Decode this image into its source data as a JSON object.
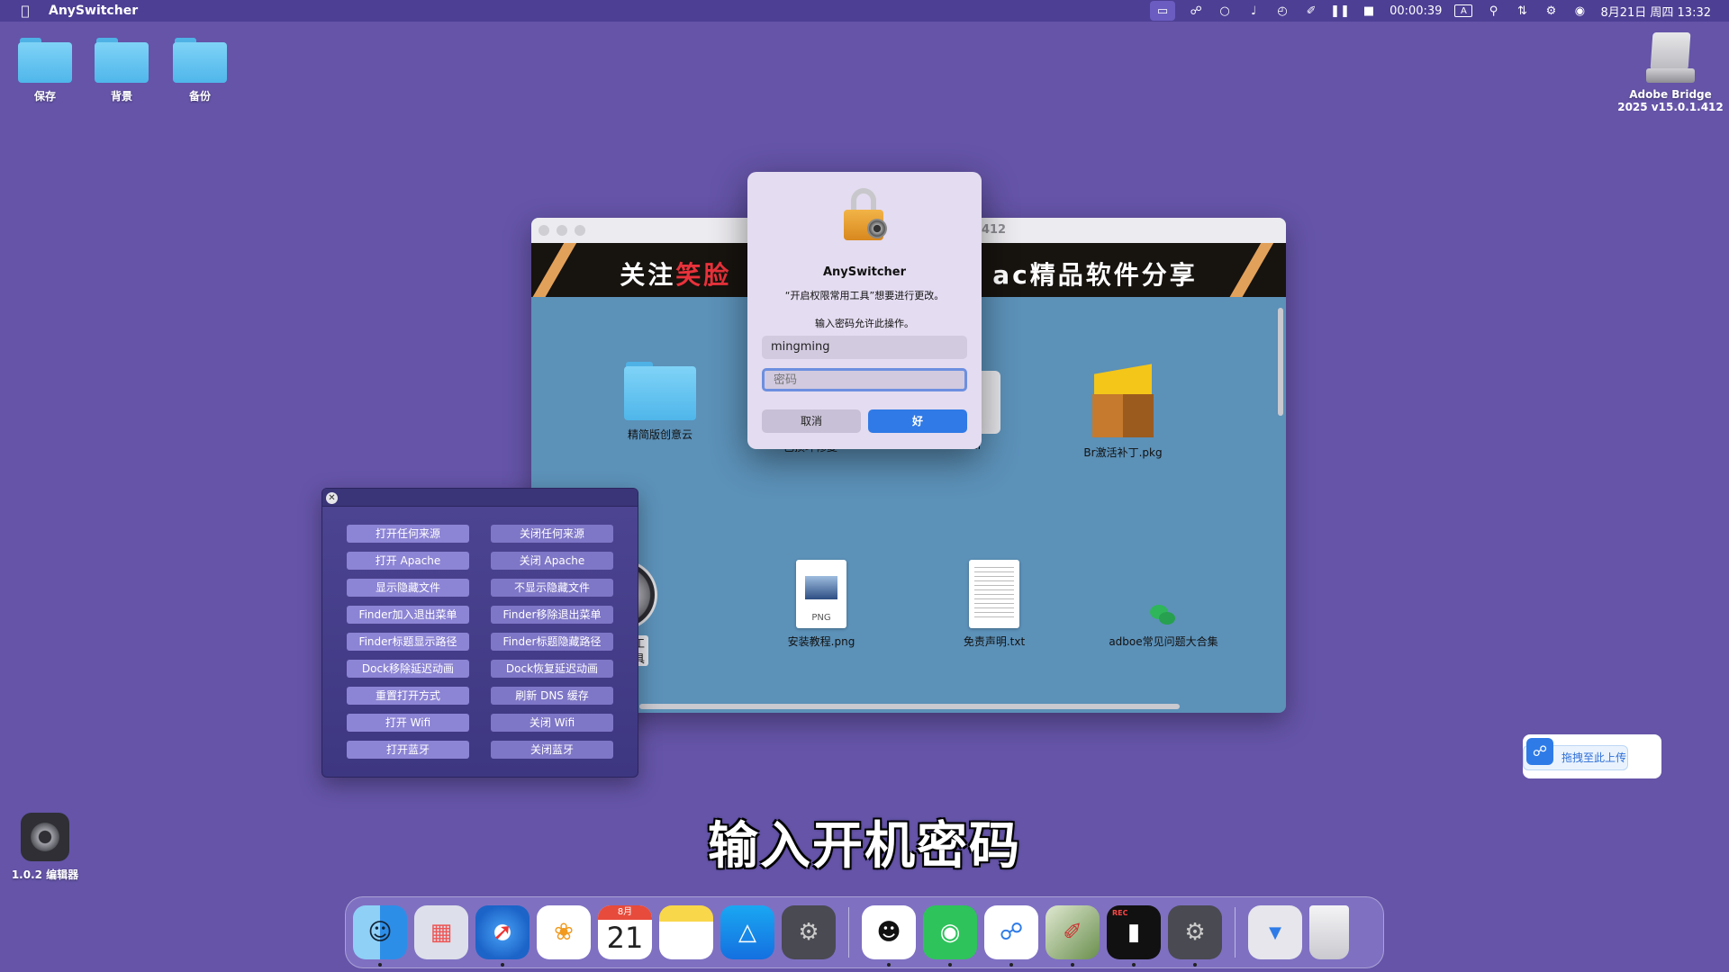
{
  "menubar": {
    "app_name": "AnySwitcher",
    "timer": "00:00:39",
    "input_mode": "A",
    "datetime": "8月21日 周四 13:32"
  },
  "desktop": {
    "folders": [
      {
        "label": "保存"
      },
      {
        "label": "背景"
      },
      {
        "label": "备份"
      }
    ],
    "disk_label_line1": "Adobe Bridge",
    "disk_label_line2": "2025 v15.0.1.412",
    "editor_label": "1.0.2 编辑器"
  },
  "finder_window": {
    "title": ".412",
    "banner_left": "关注",
    "banner_highlight": "笑脸",
    "banner_right": "ac精品软件分享",
    "items_row1": [
      {
        "label": "精简版创意云"
      },
      {
        "label": "已损坏修复"
      },
      {
        "label": "Install"
      },
      {
        "label": "Br激活补丁.pkg"
      }
    ],
    "items_row2": [
      {
        "label": "启权限常用工具"
      },
      {
        "label": "安装教程.png",
        "tag": "PNG"
      },
      {
        "label": "免责声明.txt"
      },
      {
        "label": "adboe常见问题大合集"
      }
    ]
  },
  "auth_dialog": {
    "title": "AnySwitcher",
    "message": "“开启权限常用工具”想要进行更改。",
    "prompt": "输入密码允许此操作。",
    "username": "mingming",
    "password_placeholder": "密码",
    "cancel_label": "取消",
    "ok_label": "好"
  },
  "tool_panel": {
    "buttons": [
      [
        "打开任何来源",
        "关闭任何来源"
      ],
      [
        "打开 Apache",
        "关闭 Apache"
      ],
      [
        "显示隐藏文件",
        "不显示隐藏文件"
      ],
      [
        "Finder加入退出菜单",
        "Finder移除退出菜单"
      ],
      [
        "Finder标题显示路径",
        "Finder标题隐藏路径"
      ],
      [
        "Dock移除延迟动画",
        "Dock恢复延迟动画"
      ],
      [
        "重置打开方式",
        "刷新 DNS 缓存"
      ],
      [
        "打开 Wifi",
        "关闭 Wifi"
      ],
      [
        "打开蓝牙",
        "关闭蓝牙"
      ]
    ]
  },
  "upload_widget": {
    "label": "拖拽至此上传"
  },
  "subtitle": "输入开机密码",
  "dock": {
    "calendar_month": "8月",
    "calendar_day": "21",
    "facetime_badge": "REC"
  },
  "colors": {
    "desktop_bg": "#6554a8",
    "accent_blue": "#2f7ae6",
    "banner_highlight": "#e8323b",
    "tool_button": "#8c84d4"
  },
  "icons": [
    "apple-icon",
    "folder-icon",
    "disk-icon",
    "lock-icon",
    "gear-icon",
    "finder-icon",
    "launchpad-icon",
    "safari-icon",
    "photos-icon",
    "calendar-icon",
    "notes-icon",
    "appstore-icon",
    "settings-icon",
    "qq-icon",
    "wechat-icon",
    "baidu-netdisk-icon",
    "editor-icon",
    "recorder-icon",
    "trash-icon"
  ]
}
